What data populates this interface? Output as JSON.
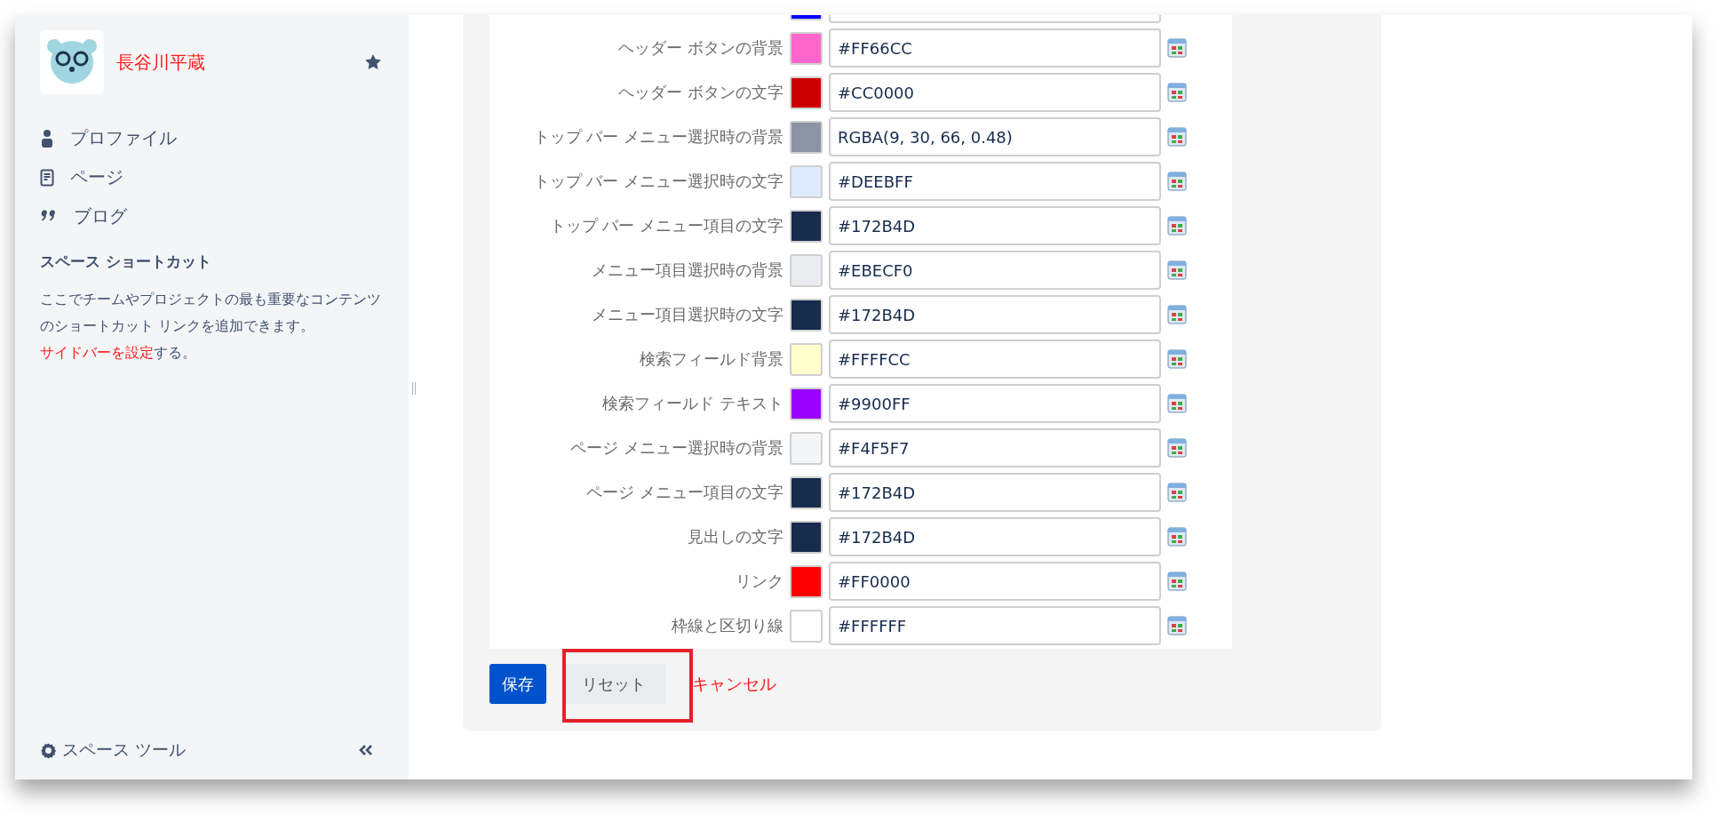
{
  "sidebar": {
    "space_name": "長谷川平蔵",
    "nav_items": [
      {
        "kind": "person",
        "label": "プロファイル"
      },
      {
        "kind": "page",
        "label": "ページ"
      },
      {
        "kind": "quote",
        "label": "ブログ"
      }
    ],
    "shortcuts_heading": "スペース ショートカット",
    "shortcuts_text": "ここでチームやプロジェクトの最も重要なコンテンツのショートカット リンクを追加できます。",
    "shortcuts_link": "サイドバーを設定",
    "shortcuts_after": "する。",
    "space_tools": "スペース ツール"
  },
  "color_rows": [
    {
      "color": "#0000ff"
    },
    {
      "label": "ヘッダー ボタンの背景",
      "color": "#ff66cc",
      "value": "#FF66CC"
    },
    {
      "label": "ヘッダー ボタンの文字",
      "color": "#cc0000",
      "value": "#CC0000"
    },
    {
      "label": "トップ バー メニュー選択時の背景",
      "color": "#8c93a4",
      "value": "RGBA(9, 30, 66, 0.48)"
    },
    {
      "label": "トップ バー メニュー選択時の文字",
      "color": "#deebff",
      "value": "#DEEBFF"
    },
    {
      "label": "トップ バー メニュー項目の文字",
      "color": "#172b4d",
      "value": "#172B4D"
    },
    {
      "label": "メニュー項目選択時の背景",
      "color": "#ebecf0",
      "value": "#EBECF0"
    },
    {
      "label": "メニュー項目選択時の文字",
      "color": "#172b4d",
      "value": "#172B4D"
    },
    {
      "label": "検索フィールド背景",
      "color": "#ffffcc",
      "value": "#FFFFCC"
    },
    {
      "label": "検索フィールド テキスト",
      "color": "#9900ff",
      "value": "#9900FF"
    },
    {
      "label": "ページ メニュー選択時の背景",
      "color": "#f4f5f7",
      "value": "#F4F5F7"
    },
    {
      "label": "ページ メニュー項目の文字",
      "color": "#172b4d",
      "value": "#172B4D"
    },
    {
      "label": "見出しの文字",
      "color": "#172b4d",
      "value": "#172B4D"
    },
    {
      "label": "リンク",
      "color": "#ff0000",
      "value": "#FF0000"
    },
    {
      "label": "枠線と区切り線",
      "color": "#ffffff",
      "value": "#FFFFFF"
    }
  ],
  "buttons": {
    "save": "保存",
    "reset": "リセット",
    "cancel": "キャンセル"
  }
}
